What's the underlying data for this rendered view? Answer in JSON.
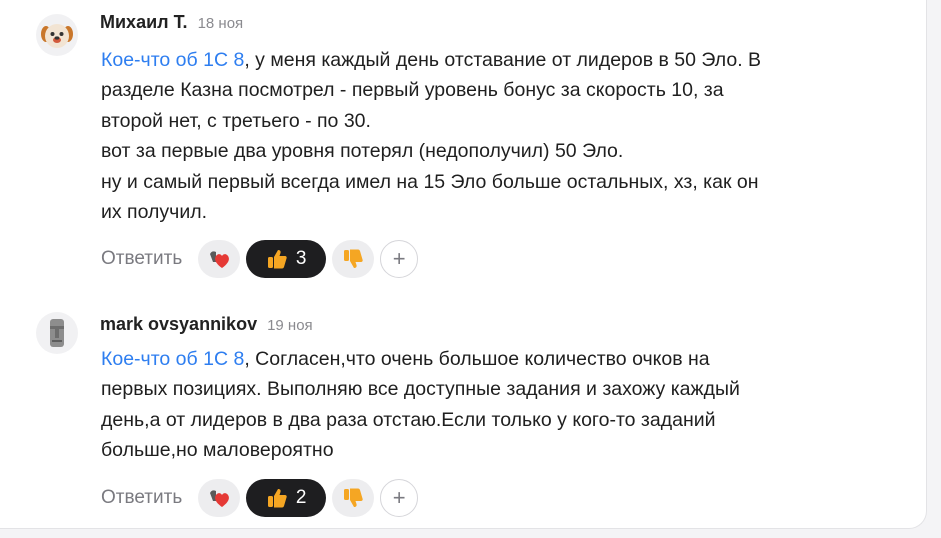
{
  "comments": [
    {
      "author": "Михаил Т.",
      "date": "18 ноя",
      "mention": "Кое-что об 1С 8",
      "text": ", у меня каждый день отставание от лидеров в 50 Эло. В\nразделе Казна посмотрел - первый уровень бонус за скорость 10, за\nвторой нет, с третьего - по 30.\nвот за первые два уровня потерял (недополучил) 50 Эло.\nну и самый первый всегда имел на 15 Эло больше остальных, хз, как он\nих получил.",
      "reply_label": "Ответить",
      "reactions": {
        "like_count": "3"
      },
      "avatar_icon": "dog-avatar-icon"
    },
    {
      "author": "mark ovsyannikov",
      "date": "19 ноя",
      "mention": "Кое-что об 1С 8",
      "text": ", Согласен,что очень большое количество очков на\nпервых позициях. Выполняю все доступные задания и захожу каждый\nдень,а от лидеров в два раза отстаю.Если только у кого-то заданий\nбольше,но маловероятно",
      "reply_label": "Ответить",
      "reactions": {
        "like_count": "2"
      },
      "avatar_icon": "moai-avatar-icon"
    }
  ],
  "icons": {
    "heart_reaction": "heart-reaction-icon",
    "thumbs_up": "thumbs-up-icon",
    "thumbs_down": "thumbs-down-icon",
    "add_reaction": "plus-icon"
  },
  "colors": {
    "link": "#2e7ef0",
    "dark_pill": "#1e1e20",
    "light_pill": "#ededef",
    "thumb": "#f5a623"
  }
}
